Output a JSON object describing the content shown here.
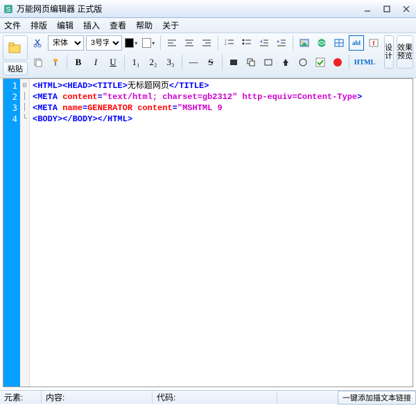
{
  "window": {
    "title": "万能网页编辑器 正式版"
  },
  "menu": {
    "items": [
      "文件",
      "排版",
      "编辑",
      "插入",
      "查看",
      "帮助",
      "关于"
    ]
  },
  "toolbar": {
    "paste": "粘贴",
    "font_family": "宋体",
    "font_size": "3号字",
    "color1": "#000000",
    "color2": "#ffffff",
    "design": "设计",
    "html": "HTML",
    "preview": "效果\n预览",
    "bold": "B",
    "italic": "I",
    "underline": "U",
    "h1": "1₁",
    "h2": "2₂",
    "h3": "3₃",
    "strike": "S"
  },
  "code": {
    "lines": [
      "1",
      "2",
      "3",
      "4"
    ],
    "l1_a": "<HTML><HEAD><TITLE>",
    "l1_t": "无标题网页",
    "l1_b": "</TITLE>",
    "l2_a": "<META ",
    "l2_b": "content",
    "l2_c": "=",
    "l2_d": "\"text/html; charset=gb2312\" http-equiv=Content-Type",
    "l2_e": ">",
    "l3_a": "<META ",
    "l3_b": "name",
    "l3_c": "=",
    "l3_d": "GENERATOR ",
    "l3_e": "content",
    "l3_f": "=",
    "l3_g": "\"MSHTML 9",
    "l4_a": "<BODY></BODY></HTML>"
  },
  "status": {
    "elem": "元素:",
    "content": "内容:",
    "code": "代码:",
    "link_btn": "一键添加描文本链接"
  }
}
